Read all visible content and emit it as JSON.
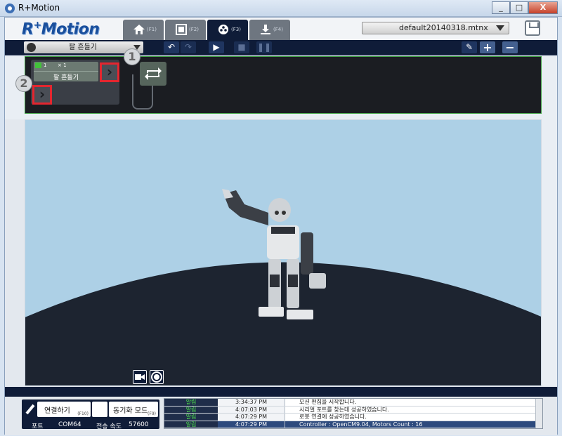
{
  "window": {
    "title": "R+Motion",
    "buttons": [
      "_",
      "□",
      "X"
    ]
  },
  "header": {
    "logo": "R+Motion",
    "tabs": [
      {
        "icon": "home-icon",
        "key": "(F1)",
        "active": false
      },
      {
        "icon": "film-icon",
        "key": "(F2)",
        "active": false
      },
      {
        "icon": "reel-icon",
        "key": "(F3)",
        "active": true
      },
      {
        "icon": "download-icon",
        "key": "(F4)",
        "active": false
      }
    ],
    "file": "default20140318.mtnx"
  },
  "toolbar": {
    "motion": "팔 흔들기"
  },
  "flow": {
    "card": {
      "loop": "1",
      "times": "× 1",
      "name": "팔 흔들기"
    },
    "callouts": [
      "1",
      "2"
    ],
    "arrow": "›"
  },
  "bottom": {
    "connect": {
      "label": "연결하기",
      "key": "(F10)"
    },
    "sync": {
      "label": "동기화 모드",
      "key": "(F9)"
    },
    "port_label": "포트",
    "port_value": "COM64",
    "speed_label": "전송 속도",
    "speed_value": "57600"
  },
  "log": [
    {
      "level": "알림",
      "time": "3:34:37 PM",
      "message": "모션 편집을 시작합니다."
    },
    {
      "level": "알림",
      "time": "4:07:03 PM",
      "message": "시리얼 포트를 찾는데 성공하였습니다."
    },
    {
      "level": "알림",
      "time": "4:07:29 PM",
      "message": "로봇 연결에 성공하였습니다."
    },
    {
      "level": "알림",
      "time": "4:07:29 PM",
      "message": "Controller : OpenCM9.04, Motors Count : 16",
      "selected": true
    }
  ],
  "colors": {
    "navy": "#0f1c38",
    "sky": "#add0e6",
    "ground": "#1d2430",
    "accent_red": "#e4262f",
    "log_green": "#4ce04c"
  }
}
